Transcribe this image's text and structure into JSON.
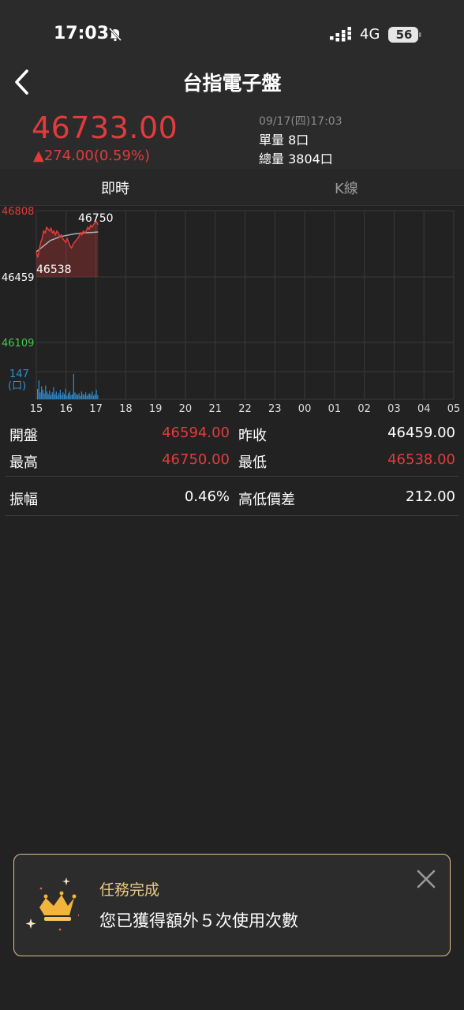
{
  "status_bar": {
    "time": "17:03",
    "network": "4G",
    "battery": "56"
  },
  "header": {
    "title": "台指電子盤"
  },
  "quote": {
    "price": "46733.00",
    "change": "▲274.00(0.59%)",
    "datetime": "09/17(四)17:03",
    "unit_volume": "單量  8口",
    "total_volume": "總量  3804口"
  },
  "tabs": [
    {
      "label": "即時"
    },
    {
      "label": "K線"
    }
  ],
  "chart": {
    "y_top": "46808",
    "y_mid": "46459",
    "y_bottom": "46109",
    "high_label": "46750",
    "low_label": "46538",
    "volume_label": "147",
    "volume_unit": "(口)",
    "x_ticks": [
      "15",
      "16",
      "17",
      "18",
      "19",
      "20",
      "21",
      "22",
      "23",
      "00",
      "01",
      "02",
      "03",
      "04",
      "05"
    ],
    "colors": {
      "up": "#e33b3b",
      "down": "#3ecb4a",
      "neutral": "#ffffff",
      "volume": "#2f8fd6",
      "average": "#aaaaaa"
    }
  },
  "stats": {
    "open_label": "開盤",
    "open_value": "46594.00",
    "prev_close_label": "昨收",
    "prev_close_value": "46459.00",
    "high_label": "最高",
    "high_value": "46750.00",
    "low_label": "最低",
    "low_value": "46538.00",
    "amplitude_label": "振幅",
    "amplitude_value": "0.46%",
    "range_label": "高低價差",
    "range_value": "212.00"
  },
  "toast": {
    "title": "任務完成",
    "message": "您已獲得額外５次使用次數"
  }
}
